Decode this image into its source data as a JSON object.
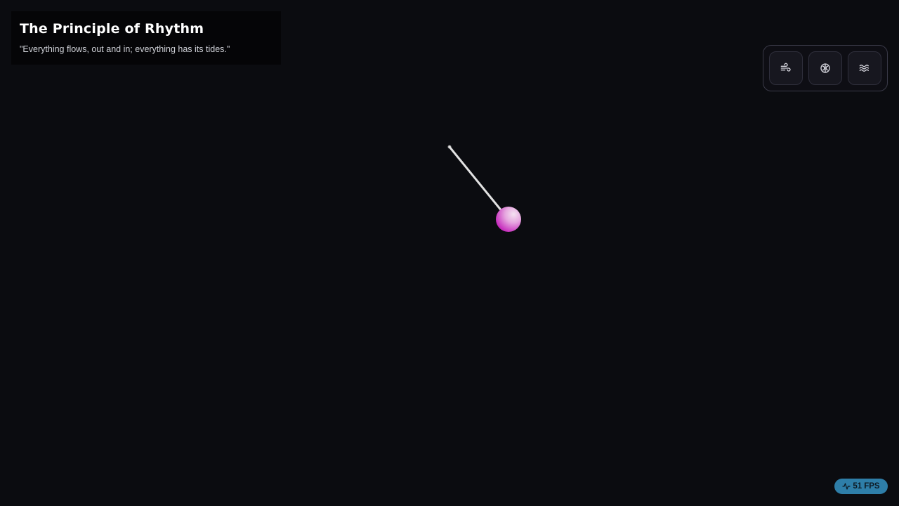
{
  "info": {
    "title": "The Principle of Rhythm",
    "quote": "\"Everything flows, out and in; everything has its tides.\""
  },
  "controls": {
    "buttons": [
      {
        "icon": "wind-icon"
      },
      {
        "icon": "brain-icon"
      },
      {
        "icon": "waves-icon"
      }
    ]
  },
  "fps": {
    "value": "51",
    "unit": "FPS",
    "icon": "activity-icon"
  },
  "colors": {
    "background": "#0b0c10",
    "bob_light": "#f3d3ee",
    "bob_dark": "#c92fc2",
    "string": "#e0e0e0",
    "fps_badge": "#2e7ea8"
  }
}
